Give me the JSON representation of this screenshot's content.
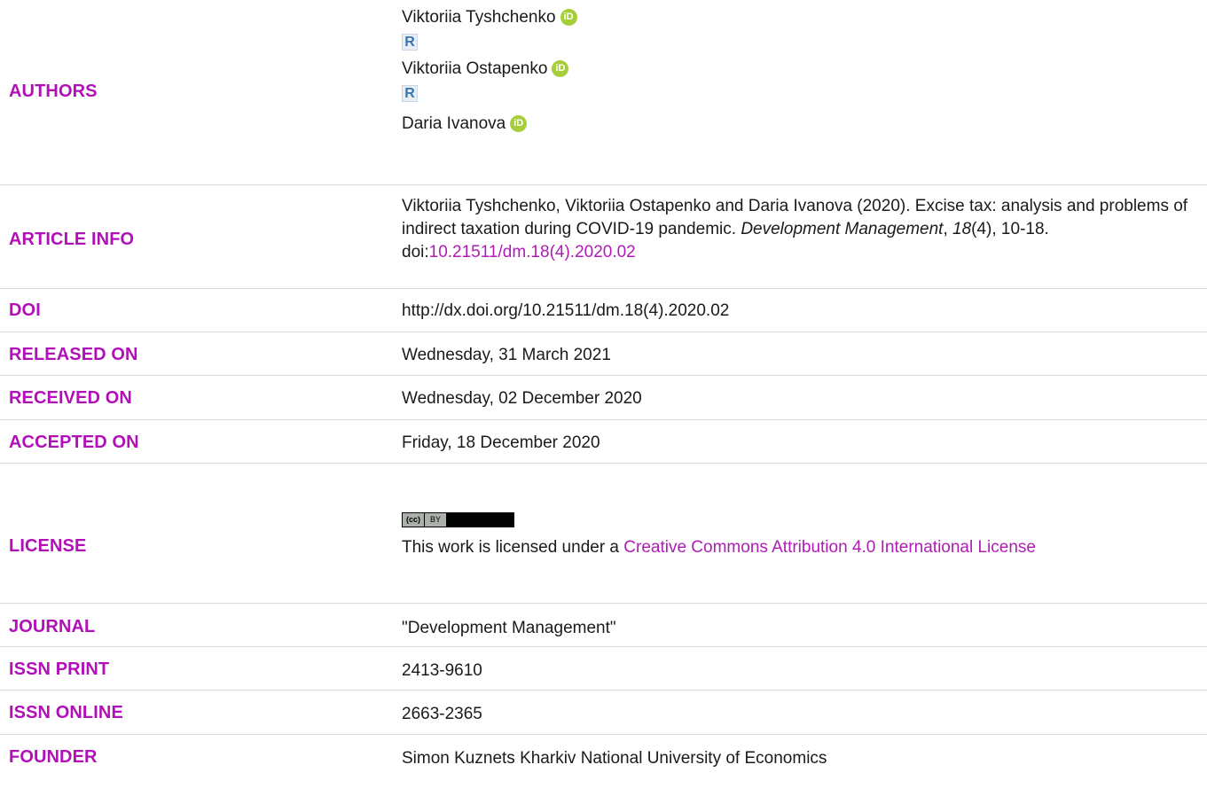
{
  "authors": {
    "label": "AUTHORS",
    "list": [
      "Viktoriia Tyshchenko",
      "Viktoriia Ostapenko",
      "Daria Ivanova"
    ],
    "orcid_icon_text": "iD",
    "researcher_icon_text": "R"
  },
  "article_info": {
    "label": "ARTICLE INFO",
    "text_1": "Viktoriia Tyshchenko, Viktoriia Ostapenko and Daria Ivanova (2020). Excise tax: analysis and problems of indirect taxation during COVID-19 pandemic. ",
    "journal": "Development Management",
    "comma": ", ",
    "volume": "18",
    "text_2": "(4), 10-18. doi:",
    "doi_link": "10.21511/dm.18(4).2020.02"
  },
  "doi": {
    "label": "DOI",
    "value": "http://dx.doi.org/10.21511/dm.18(4).2020.02"
  },
  "released": {
    "label": "RELEASED ON",
    "value": "Wednesday, 31 March 2021"
  },
  "received": {
    "label": "RECEIVED ON",
    "value": "Wednesday, 02 December 2020"
  },
  "accepted": {
    "label": "ACCEPTED ON",
    "value": "Friday, 18 December 2020"
  },
  "license": {
    "label": "LICENSE",
    "badge_cc": "(cc)",
    "badge_by": "BY",
    "text": "This work is licensed under a ",
    "link": "Creative Commons Attribution 4.0 International License"
  },
  "journal": {
    "label": "JOURNAL",
    "value": "\"Development Management\""
  },
  "issn_print": {
    "label": "ISSN PRINT",
    "value": "2413-9610"
  },
  "issn_online": {
    "label": "ISSN ONLINE",
    "value": "2663-2365"
  },
  "founder": {
    "label": "FOUNDER",
    "value": "Simon Kuznets Kharkiv National University of Economics"
  },
  "colors": {
    "label": "#b10fb7",
    "link": "#b01bb5",
    "orcid": "#a6ce39",
    "divider": "#d9d9d9"
  }
}
